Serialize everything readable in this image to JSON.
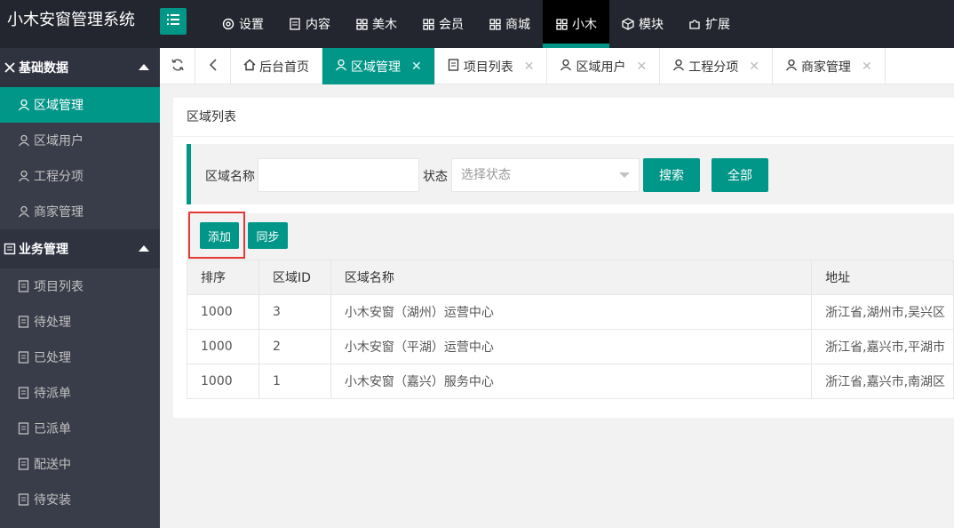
{
  "app": {
    "title": "小木安窗管理系统"
  },
  "topnav": [
    {
      "label": "设置",
      "icon": "gear-icon"
    },
    {
      "label": "内容",
      "icon": "document-icon"
    },
    {
      "label": "美木",
      "icon": "grid-icon"
    },
    {
      "label": "会员",
      "icon": "grid-icon"
    },
    {
      "label": "商城",
      "icon": "grid-icon"
    },
    {
      "label": "小木",
      "icon": "grid-icon",
      "active": true
    },
    {
      "label": "模块",
      "icon": "cube-icon"
    },
    {
      "label": "扩展",
      "icon": "puzzle-icon"
    }
  ],
  "sidebar": {
    "groups": [
      {
        "label": "基础数据",
        "icon": "tools-icon",
        "items": [
          {
            "label": "区域管理",
            "icon": "user-icon",
            "active": true
          },
          {
            "label": "区域用户",
            "icon": "user-icon"
          },
          {
            "label": "工程分项",
            "icon": "user-icon"
          },
          {
            "label": "商家管理",
            "icon": "user-icon"
          }
        ]
      },
      {
        "label": "业务管理",
        "icon": "list-icon",
        "items": [
          {
            "label": "项目列表",
            "icon": "edit-doc-icon"
          },
          {
            "label": "待处理",
            "icon": "edit-doc-icon"
          },
          {
            "label": "已处理",
            "icon": "edit-doc-icon"
          },
          {
            "label": "待派单",
            "icon": "edit-doc-icon"
          },
          {
            "label": "已派单",
            "icon": "edit-doc-icon"
          },
          {
            "label": "配送中",
            "icon": "edit-doc-icon"
          },
          {
            "label": "待安装",
            "icon": "edit-doc-icon"
          }
        ]
      }
    ]
  },
  "tabs": [
    {
      "label": "后台首页",
      "icon": "home-icon",
      "closable": false
    },
    {
      "label": "区域管理",
      "icon": "user-icon",
      "closable": true,
      "active": true
    },
    {
      "label": "项目列表",
      "icon": "edit-doc-icon",
      "closable": true
    },
    {
      "label": "区域用户",
      "icon": "user-icon",
      "closable": true
    },
    {
      "label": "工程分项",
      "icon": "user-icon",
      "closable": true
    },
    {
      "label": "商家管理",
      "icon": "user-icon",
      "closable": true
    }
  ],
  "main": {
    "card_title": "区域列表",
    "search": {
      "name_label": "区域名称",
      "name_value": "",
      "status_label": "状态",
      "status_placeholder": "选择状态",
      "search_button": "搜索",
      "all_button": "全部"
    },
    "toolbar": {
      "add_button": "添加",
      "sync_button": "同步"
    },
    "table": {
      "columns": [
        "排序",
        "区域ID",
        "区域名称",
        "地址"
      ],
      "rows": [
        [
          "1000",
          "3",
          "小木安窗（湖州）运营中心",
          "浙江省,湖州市,吴兴区"
        ],
        [
          "1000",
          "2",
          "小木安窗（平湖）运营中心",
          "浙江省,嘉兴市,平湖市"
        ],
        [
          "1000",
          "1",
          "小木安窗（嘉兴）服务中心",
          "浙江省,嘉兴市,南湖区"
        ]
      ]
    }
  },
  "colors": {
    "accent": "#009688",
    "header": "#23262e",
    "sidebar": "#393d49",
    "highlight": "#e53935"
  }
}
